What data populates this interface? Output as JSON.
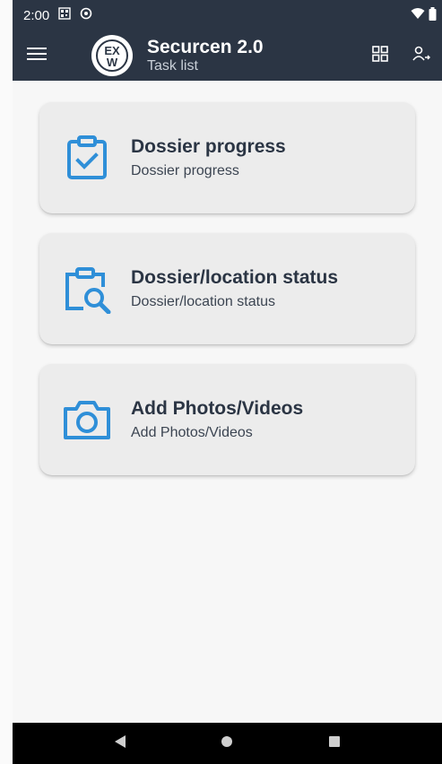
{
  "status_bar": {
    "time": "2:00"
  },
  "app_bar": {
    "title": "Securcen 2.0",
    "subtitle": "Task list",
    "logo_text_top": "EX",
    "logo_text_bottom": "W"
  },
  "tasks": [
    {
      "title": "Dossier progress",
      "subtitle": "Dossier progress",
      "icon": "clipboard-check-icon"
    },
    {
      "title": "Dossier/location status",
      "subtitle": "Dossier/location status",
      "icon": "clipboard-search-icon"
    },
    {
      "title": "Add Photos/Videos",
      "subtitle": "Add Photos/Videos",
      "icon": "camera-icon"
    }
  ],
  "colors": {
    "app_bar": "#2b3544",
    "accent_icon": "#2f8fd8",
    "card_bg": "#ececec"
  }
}
